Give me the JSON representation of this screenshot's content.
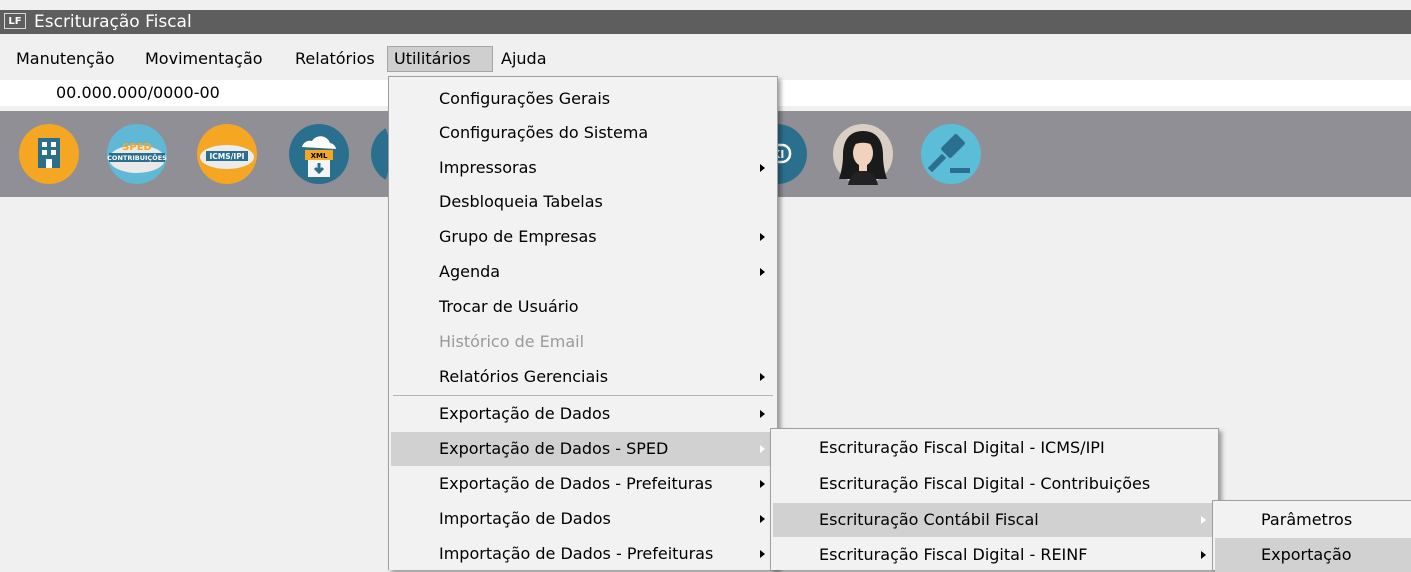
{
  "window": {
    "app_icon": "LF",
    "title": "Escrituração Fiscal"
  },
  "menubar": {
    "items": [
      "Manutenção",
      "Movimentação",
      "Relatórios",
      "Utilitários",
      "Ajuda"
    ]
  },
  "company": {
    "cnpj": "00.000.000/0000-00"
  },
  "toolbar": {
    "buttons": [
      {
        "icon": "building-icon"
      },
      {
        "icon": "sped-contribuicoes-icon",
        "top": "SPED",
        "bottom": "CONTRIBUIÇÕES"
      },
      {
        "icon": "icms-ipi-icon",
        "label": "ICMS/IPI"
      },
      {
        "icon": "xml-download-icon",
        "label": "XML"
      },
      {
        "icon": "partial-icon"
      },
      {
        "icon": "wiki-icon",
        "label": "KI"
      },
      {
        "icon": "assistant-avatar-icon"
      },
      {
        "icon": "gavel-icon"
      }
    ]
  },
  "utilitarios_menu": {
    "items": [
      {
        "label": "Configurações Gerais"
      },
      {
        "label": "Configurações do Sistema"
      },
      {
        "label": "Impressoras"
      },
      {
        "label": "Desbloqueia Tabelas"
      },
      {
        "label": "Grupo de Empresas"
      },
      {
        "label": "Agenda"
      },
      {
        "label": "Trocar de Usuário"
      },
      {
        "label": "Histórico de Email"
      },
      {
        "label": "Relatórios Gerenciais"
      },
      {
        "label": "Exportação de Dados"
      },
      {
        "label": "Exportação de Dados - SPED"
      },
      {
        "label": "Exportação de Dados - Prefeituras"
      },
      {
        "label": "Importação de Dados"
      },
      {
        "label": "Importação de Dados - Prefeituras"
      }
    ]
  },
  "sped_submenu": {
    "items": [
      {
        "label": "Escrituração Fiscal Digital - ICMS/IPI"
      },
      {
        "label": "Escrituração Fiscal Digital - Contribuições"
      },
      {
        "label": "Escrituração Contábil Fiscal"
      },
      {
        "label": "Escrituração Fiscal Digital - REINF"
      }
    ]
  },
  "ecf_submenu": {
    "items": [
      {
        "label": "Parâmetros"
      },
      {
        "label": "Exportação"
      }
    ]
  }
}
